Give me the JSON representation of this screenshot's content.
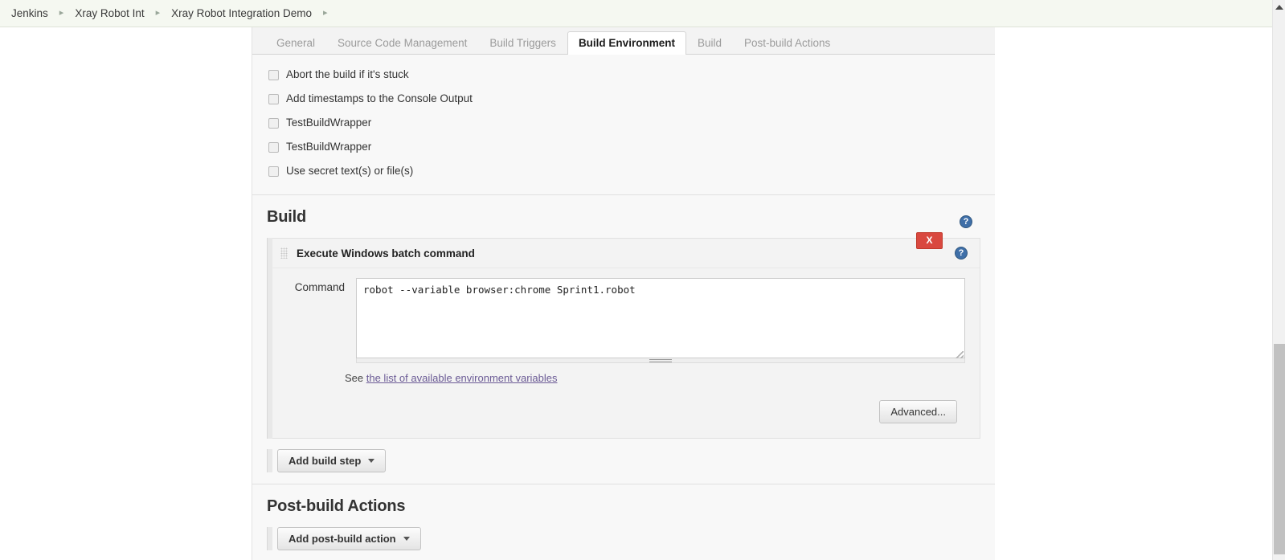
{
  "breadcrumb": {
    "items": [
      {
        "label": "Jenkins"
      },
      {
        "label": "Xray Robot Int"
      },
      {
        "label": "Xray Robot Integration Demo"
      }
    ],
    "separator": "▸"
  },
  "tabs": [
    {
      "label": "General",
      "active": false
    },
    {
      "label": "Source Code Management",
      "active": false
    },
    {
      "label": "Build Triggers",
      "active": false
    },
    {
      "label": "Build Environment",
      "active": true
    },
    {
      "label": "Build",
      "active": false
    },
    {
      "label": "Post-build Actions",
      "active": false
    }
  ],
  "build_environment": {
    "checkboxes": [
      {
        "label": "Abort the build if it's stuck",
        "checked": false
      },
      {
        "label": "Add timestamps to the Console Output",
        "checked": false
      },
      {
        "label": "TestBuildWrapper",
        "checked": false
      },
      {
        "label": "TestBuildWrapper",
        "checked": false
      },
      {
        "label": "Use secret text(s) or file(s)",
        "checked": false
      }
    ],
    "help_glyph": "?"
  },
  "build_section": {
    "title": "Build",
    "step": {
      "title": "Execute Windows batch command",
      "delete_label": "X",
      "help_glyph": "?",
      "command_label": "Command",
      "command_value": "robot --variable browser:chrome Sprint1.robot",
      "command_placeholder": "",
      "note_prefix": "See ",
      "note_link": "the list of available environment variables",
      "advanced_label": "Advanced..."
    },
    "add_button_label": "Add build step"
  },
  "postbuild_section": {
    "title": "Post-build Actions",
    "add_button_label": "Add post-build action"
  },
  "colors": {
    "accent_blue": "#3f6fa8",
    "delete_red": "#d9483f",
    "link_purple": "#6b5b95",
    "breadcrumb_bg": "#f5f8f1"
  }
}
